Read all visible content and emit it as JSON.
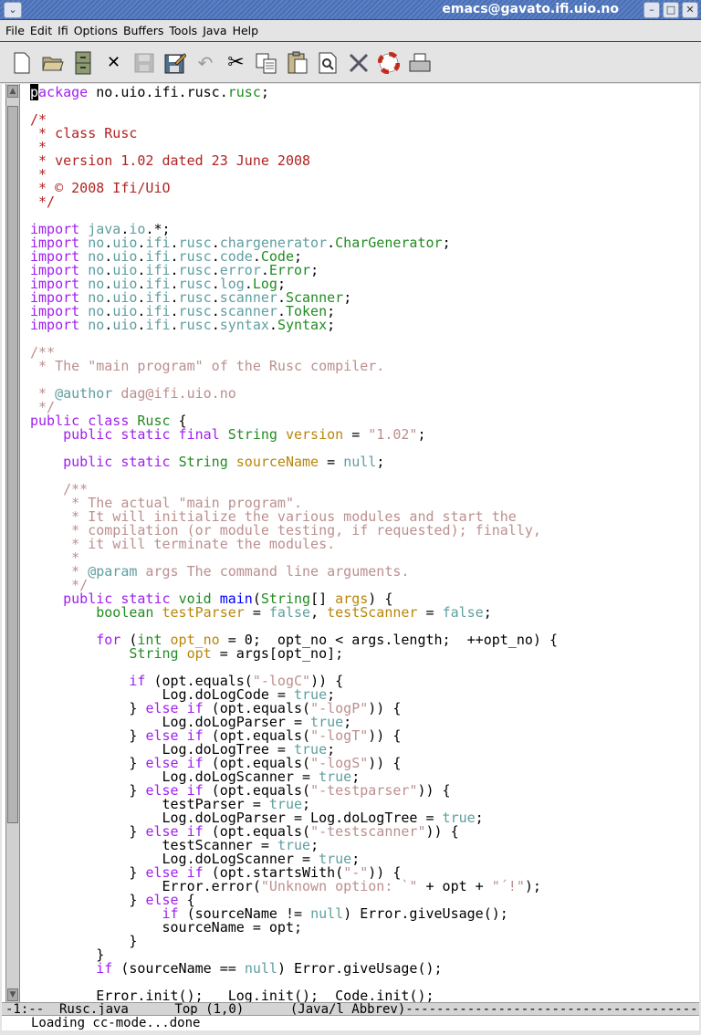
{
  "window": {
    "title": "emacs@gavato.ifi.uio.no",
    "controls": [
      "minimize",
      "maximize",
      "close"
    ]
  },
  "menu": [
    "File",
    "Edit",
    "Ifi",
    "Options",
    "Buffers",
    "Tools",
    "Java",
    "Help"
  ],
  "toolbar": [
    {
      "icon": "new-file-icon"
    },
    {
      "icon": "open-folder-icon"
    },
    {
      "icon": "dired-cabinet-icon"
    },
    {
      "icon": "close-buffer-icon"
    },
    {
      "icon": "save-icon",
      "disabled": true
    },
    {
      "icon": "save-as-icon"
    },
    {
      "icon": "undo-icon",
      "disabled": true
    },
    {
      "icon": "cut-icon"
    },
    {
      "icon": "copy-icon"
    },
    {
      "icon": "paste-icon"
    },
    {
      "icon": "search-icon"
    },
    {
      "icon": "customize-tools-icon"
    },
    {
      "icon": "help-lifebuoy-icon"
    },
    {
      "icon": "print-icon"
    }
  ],
  "colors": {
    "keyword": "#a020f0",
    "type": "#228b22",
    "constant": "#5f9ea0",
    "variable": "#b8860b",
    "function": "#0000ff",
    "string": "#bc8f8f",
    "comment": "#b22222",
    "doc": "#bc8f8f"
  },
  "code": [
    [
      [
        "cur",
        "p"
      ],
      [
        "k",
        "ackage"
      ],
      [
        "p",
        " no.uio.ifi.rusc."
      ],
      [
        "t",
        "rusc"
      ],
      [
        "p",
        ";"
      ]
    ],
    [],
    [
      [
        "m",
        "/*"
      ]
    ],
    [
      [
        "m",
        " * class Rusc"
      ]
    ],
    [
      [
        "m",
        " *"
      ]
    ],
    [
      [
        "m",
        " * version 1.02 dated 23 June 2008"
      ]
    ],
    [
      [
        "m",
        " *"
      ]
    ],
    [
      [
        "m",
        " * © 2008 Ifi/UiO"
      ]
    ],
    [
      [
        "m",
        " */"
      ]
    ],
    [],
    [
      [
        "k",
        "import"
      ],
      [
        "p",
        " "
      ],
      [
        "c",
        "java"
      ],
      [
        "p",
        "."
      ],
      [
        "c",
        "io"
      ],
      [
        "p",
        ".*;"
      ]
    ],
    [
      [
        "k",
        "import"
      ],
      [
        "p",
        " "
      ],
      [
        "c",
        "no"
      ],
      [
        "p",
        "."
      ],
      [
        "c",
        "uio"
      ],
      [
        "p",
        "."
      ],
      [
        "c",
        "ifi"
      ],
      [
        "p",
        "."
      ],
      [
        "c",
        "rusc"
      ],
      [
        "p",
        "."
      ],
      [
        "c",
        "chargenerator"
      ],
      [
        "p",
        "."
      ],
      [
        "t",
        "CharGenerator"
      ],
      [
        "p",
        ";"
      ]
    ],
    [
      [
        "k",
        "import"
      ],
      [
        "p",
        " "
      ],
      [
        "c",
        "no"
      ],
      [
        "p",
        "."
      ],
      [
        "c",
        "uio"
      ],
      [
        "p",
        "."
      ],
      [
        "c",
        "ifi"
      ],
      [
        "p",
        "."
      ],
      [
        "c",
        "rusc"
      ],
      [
        "p",
        "."
      ],
      [
        "c",
        "code"
      ],
      [
        "p",
        "."
      ],
      [
        "t",
        "Code"
      ],
      [
        "p",
        ";"
      ]
    ],
    [
      [
        "k",
        "import"
      ],
      [
        "p",
        " "
      ],
      [
        "c",
        "no"
      ],
      [
        "p",
        "."
      ],
      [
        "c",
        "uio"
      ],
      [
        "p",
        "."
      ],
      [
        "c",
        "ifi"
      ],
      [
        "p",
        "."
      ],
      [
        "c",
        "rusc"
      ],
      [
        "p",
        "."
      ],
      [
        "c",
        "error"
      ],
      [
        "p",
        "."
      ],
      [
        "t",
        "Error"
      ],
      [
        "p",
        ";"
      ]
    ],
    [
      [
        "k",
        "import"
      ],
      [
        "p",
        " "
      ],
      [
        "c",
        "no"
      ],
      [
        "p",
        "."
      ],
      [
        "c",
        "uio"
      ],
      [
        "p",
        "."
      ],
      [
        "c",
        "ifi"
      ],
      [
        "p",
        "."
      ],
      [
        "c",
        "rusc"
      ],
      [
        "p",
        "."
      ],
      [
        "c",
        "log"
      ],
      [
        "p",
        "."
      ],
      [
        "t",
        "Log"
      ],
      [
        "p",
        ";"
      ]
    ],
    [
      [
        "k",
        "import"
      ],
      [
        "p",
        " "
      ],
      [
        "c",
        "no"
      ],
      [
        "p",
        "."
      ],
      [
        "c",
        "uio"
      ],
      [
        "p",
        "."
      ],
      [
        "c",
        "ifi"
      ],
      [
        "p",
        "."
      ],
      [
        "c",
        "rusc"
      ],
      [
        "p",
        "."
      ],
      [
        "c",
        "scanner"
      ],
      [
        "p",
        "."
      ],
      [
        "t",
        "Scanner"
      ],
      [
        "p",
        ";"
      ]
    ],
    [
      [
        "k",
        "import"
      ],
      [
        "p",
        " "
      ],
      [
        "c",
        "no"
      ],
      [
        "p",
        "."
      ],
      [
        "c",
        "uio"
      ],
      [
        "p",
        "."
      ],
      [
        "c",
        "ifi"
      ],
      [
        "p",
        "."
      ],
      [
        "c",
        "rusc"
      ],
      [
        "p",
        "."
      ],
      [
        "c",
        "scanner"
      ],
      [
        "p",
        "."
      ],
      [
        "t",
        "Token"
      ],
      [
        "p",
        ";"
      ]
    ],
    [
      [
        "k",
        "import"
      ],
      [
        "p",
        " "
      ],
      [
        "c",
        "no"
      ],
      [
        "p",
        "."
      ],
      [
        "c",
        "uio"
      ],
      [
        "p",
        "."
      ],
      [
        "c",
        "ifi"
      ],
      [
        "p",
        "."
      ],
      [
        "c",
        "rusc"
      ],
      [
        "p",
        "."
      ],
      [
        "c",
        "syntax"
      ],
      [
        "p",
        "."
      ],
      [
        "t",
        "Syntax"
      ],
      [
        "p",
        ";"
      ]
    ],
    [],
    [
      [
        "d",
        "/**"
      ]
    ],
    [
      [
        "d",
        " * The \"main program\" of the Rusc compiler."
      ]
    ],
    [],
    [
      [
        "d",
        " * "
      ],
      [
        "a",
        "@author"
      ],
      [
        "d",
        " dag@ifi.uio.no"
      ]
    ],
    [
      [
        "d",
        " */"
      ]
    ],
    [
      [
        "k",
        "public class"
      ],
      [
        "p",
        " "
      ],
      [
        "t",
        "Rusc"
      ],
      [
        "p",
        " {"
      ]
    ],
    [
      [
        "p",
        "    "
      ],
      [
        "k",
        "public static final"
      ],
      [
        "p",
        " "
      ],
      [
        "t",
        "String"
      ],
      [
        "p",
        " "
      ],
      [
        "v",
        "version"
      ],
      [
        "p",
        " = "
      ],
      [
        "s",
        "\"1.02\""
      ],
      [
        "p",
        ";"
      ]
    ],
    [],
    [
      [
        "p",
        "    "
      ],
      [
        "k",
        "public static"
      ],
      [
        "p",
        " "
      ],
      [
        "t",
        "String"
      ],
      [
        "p",
        " "
      ],
      [
        "v",
        "sourceName"
      ],
      [
        "p",
        " = "
      ],
      [
        "c",
        "null"
      ],
      [
        "p",
        ";"
      ]
    ],
    [],
    [
      [
        "p",
        "    "
      ],
      [
        "d",
        "/**"
      ]
    ],
    [
      [
        "p",
        "    "
      ],
      [
        "d",
        " * The actual \"main program\"."
      ]
    ],
    [
      [
        "p",
        "    "
      ],
      [
        "d",
        " * It will initialize the various modules and start the"
      ]
    ],
    [
      [
        "p",
        "    "
      ],
      [
        "d",
        " * compilation (or module testing, if requested); finally,"
      ]
    ],
    [
      [
        "p",
        "    "
      ],
      [
        "d",
        " * it will terminate the modules."
      ]
    ],
    [
      [
        "p",
        "    "
      ],
      [
        "d",
        " *"
      ]
    ],
    [
      [
        "p",
        "    "
      ],
      [
        "d",
        " * "
      ],
      [
        "a",
        "@param"
      ],
      [
        "d",
        " args The command line arguments."
      ]
    ],
    [
      [
        "p",
        "    "
      ],
      [
        "d",
        " */"
      ]
    ],
    [
      [
        "p",
        "    "
      ],
      [
        "k",
        "public static"
      ],
      [
        "p",
        " "
      ],
      [
        "t",
        "void"
      ],
      [
        "p",
        " "
      ],
      [
        "f",
        "main"
      ],
      [
        "p",
        "("
      ],
      [
        "t",
        "String"
      ],
      [
        "p",
        "[] "
      ],
      [
        "v",
        "args"
      ],
      [
        "p",
        ") {"
      ]
    ],
    [
      [
        "p",
        "        "
      ],
      [
        "t",
        "boolean"
      ],
      [
        "p",
        " "
      ],
      [
        "v",
        "testParser"
      ],
      [
        "p",
        " = "
      ],
      [
        "c",
        "false"
      ],
      [
        "p",
        ", "
      ],
      [
        "v",
        "testScanner"
      ],
      [
        "p",
        " = "
      ],
      [
        "c",
        "false"
      ],
      [
        "p",
        ";"
      ]
    ],
    [],
    [
      [
        "p",
        "        "
      ],
      [
        "k",
        "for"
      ],
      [
        "p",
        " ("
      ],
      [
        "t",
        "int"
      ],
      [
        "p",
        " "
      ],
      [
        "v",
        "opt_no"
      ],
      [
        "p",
        " = 0;  opt_no < args.length;  ++opt_no) {"
      ]
    ],
    [
      [
        "p",
        "            "
      ],
      [
        "t",
        "String"
      ],
      [
        "p",
        " "
      ],
      [
        "v",
        "opt"
      ],
      [
        "p",
        " = args[opt_no];"
      ]
    ],
    [],
    [
      [
        "p",
        "            "
      ],
      [
        "k",
        "if"
      ],
      [
        "p",
        " (opt.equals("
      ],
      [
        "s",
        "\"-logC\""
      ],
      [
        "p",
        ")) {"
      ]
    ],
    [
      [
        "p",
        "                Log.doLogCode = "
      ],
      [
        "c",
        "true"
      ],
      [
        "p",
        ";"
      ]
    ],
    [
      [
        "p",
        "            } "
      ],
      [
        "k",
        "else if"
      ],
      [
        "p",
        " (opt.equals("
      ],
      [
        "s",
        "\"-logP\""
      ],
      [
        "p",
        ")) {"
      ]
    ],
    [
      [
        "p",
        "                Log.doLogParser = "
      ],
      [
        "c",
        "true"
      ],
      [
        "p",
        ";"
      ]
    ],
    [
      [
        "p",
        "            } "
      ],
      [
        "k",
        "else if"
      ],
      [
        "p",
        " (opt.equals("
      ],
      [
        "s",
        "\"-logT\""
      ],
      [
        "p",
        ")) {"
      ]
    ],
    [
      [
        "p",
        "                Log.doLogTree = "
      ],
      [
        "c",
        "true"
      ],
      [
        "p",
        ";"
      ]
    ],
    [
      [
        "p",
        "            } "
      ],
      [
        "k",
        "else if"
      ],
      [
        "p",
        " (opt.equals("
      ],
      [
        "s",
        "\"-logS\""
      ],
      [
        "p",
        ")) {"
      ]
    ],
    [
      [
        "p",
        "                Log.doLogScanner = "
      ],
      [
        "c",
        "true"
      ],
      [
        "p",
        ";"
      ]
    ],
    [
      [
        "p",
        "            } "
      ],
      [
        "k",
        "else if"
      ],
      [
        "p",
        " (opt.equals("
      ],
      [
        "s",
        "\"-testparser\""
      ],
      [
        "p",
        ")) {"
      ]
    ],
    [
      [
        "p",
        "                testParser = "
      ],
      [
        "c",
        "true"
      ],
      [
        "p",
        ";"
      ]
    ],
    [
      [
        "p",
        "                Log.doLogParser = Log.doLogTree = "
      ],
      [
        "c",
        "true"
      ],
      [
        "p",
        ";"
      ]
    ],
    [
      [
        "p",
        "            } "
      ],
      [
        "k",
        "else if"
      ],
      [
        "p",
        " (opt.equals("
      ],
      [
        "s",
        "\"-testscanner\""
      ],
      [
        "p",
        ")) {"
      ]
    ],
    [
      [
        "p",
        "                testScanner = "
      ],
      [
        "c",
        "true"
      ],
      [
        "p",
        ";"
      ]
    ],
    [
      [
        "p",
        "                Log.doLogScanner = "
      ],
      [
        "c",
        "true"
      ],
      [
        "p",
        ";"
      ]
    ],
    [
      [
        "p",
        "            } "
      ],
      [
        "k",
        "else if"
      ],
      [
        "p",
        " (opt.startsWith("
      ],
      [
        "s",
        "\"-\""
      ],
      [
        "p",
        ")) {"
      ]
    ],
    [
      [
        "p",
        "                Error.error("
      ],
      [
        "s",
        "\"Unknown option: `\""
      ],
      [
        "p",
        " + opt + "
      ],
      [
        "s",
        "\"´!\""
      ],
      [
        "p",
        ");"
      ]
    ],
    [
      [
        "p",
        "            } "
      ],
      [
        "k",
        "else"
      ],
      [
        "p",
        " {"
      ]
    ],
    [
      [
        "p",
        "                "
      ],
      [
        "k",
        "if"
      ],
      [
        "p",
        " (sourceName != "
      ],
      [
        "c",
        "null"
      ],
      [
        "p",
        ") Error.giveUsage();"
      ]
    ],
    [
      [
        "p",
        "                sourceName = opt;"
      ]
    ],
    [
      [
        "p",
        "            }"
      ]
    ],
    [
      [
        "p",
        "        }"
      ]
    ],
    [
      [
        "p",
        "        "
      ],
      [
        "k",
        "if"
      ],
      [
        "p",
        " (sourceName == "
      ],
      [
        "c",
        "null"
      ],
      [
        "p",
        ") Error.giveUsage();"
      ]
    ],
    [],
    [
      [
        "p",
        "        Error.init();   Log.init();  Code.init();"
      ]
    ]
  ],
  "modeline": "-1:--  Rusc.java      Top (1,0)      (Java/l Abbrev)------------------------------------------------------",
  "minibuffer": "Loading cc-mode...done"
}
